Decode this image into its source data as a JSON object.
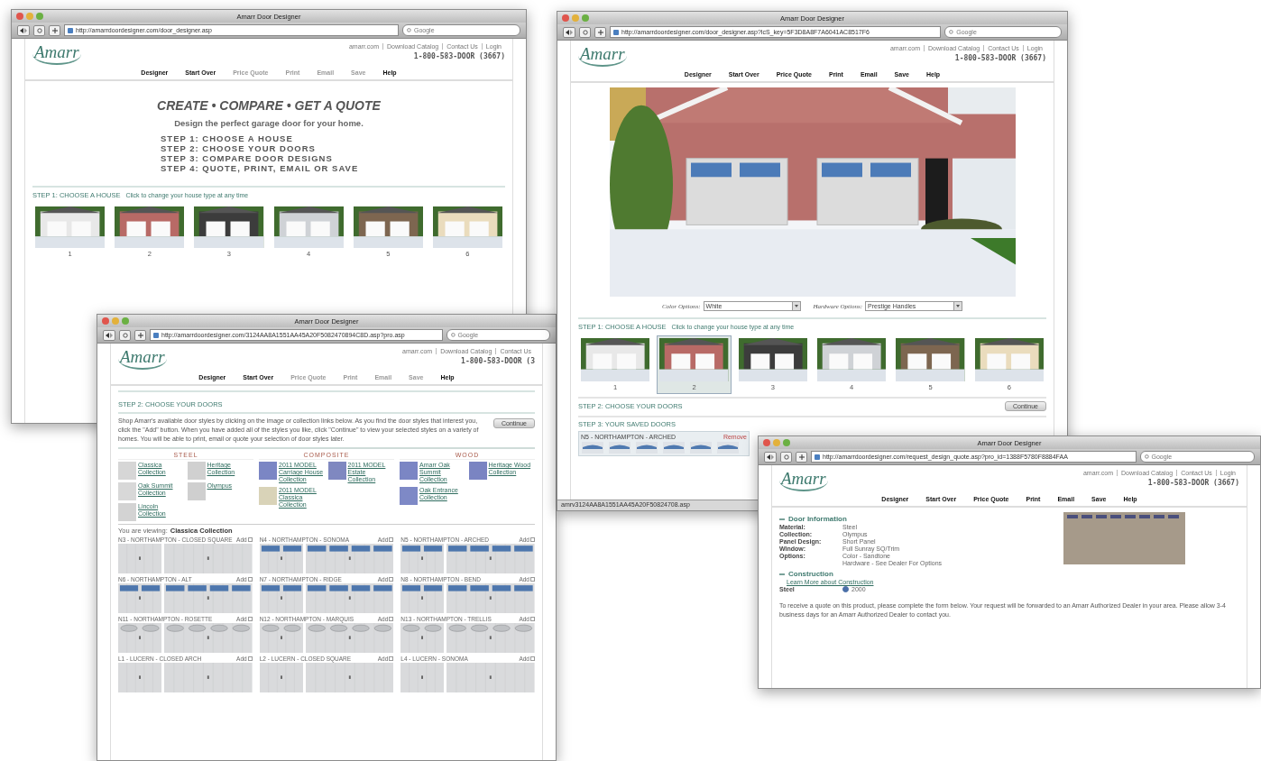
{
  "windows": [
    {
      "kind": "intro",
      "title": "Amarr Door Designer",
      "url": "http://amarrdoordesigner.com/door_designer.asp",
      "search_placeholder": "Google",
      "logo": "Amarr",
      "top_links": [
        "amarr.com",
        "Download Catalog",
        "Contact Us",
        "Login"
      ],
      "phone": "1-800-583-DOOR (3667)",
      "nav": [
        {
          "label": "Designer",
          "disabled": false
        },
        {
          "label": "Start Over",
          "disabled": false
        },
        {
          "label": "Price Quote",
          "disabled": true
        },
        {
          "label": "Print",
          "disabled": true
        },
        {
          "label": "Email",
          "disabled": true
        },
        {
          "label": "Save",
          "disabled": true
        },
        {
          "label": "Help",
          "disabled": false
        }
      ],
      "headline": "CREATE • COMPARE • GET A QUOTE",
      "subtitle": "Design the perfect garage door for your home.",
      "steps": [
        "STEP 1: CHOOSE A HOUSE",
        "STEP 2: CHOOSE YOUR DOORS",
        "STEP 3: COMPARE DOOR DESIGNS",
        "STEP 4: QUOTE, PRINT, EMAIL OR SAVE"
      ],
      "house_heading": "STEP 1: CHOOSE A HOUSE",
      "house_hint": "Click to change your house type at any time",
      "houses": [
        {
          "label": "1",
          "selected": false
        },
        {
          "label": "2",
          "selected": false
        },
        {
          "label": "3",
          "selected": false
        },
        {
          "label": "4",
          "selected": false
        },
        {
          "label": "5",
          "selected": false
        },
        {
          "label": "6",
          "selected": false
        }
      ]
    },
    {
      "kind": "catalog",
      "title": "Amarr Door Designer",
      "url": "http://amarrdoordesigner.com/3124AA8A1551AA45A20F5082470894C8D.asp?pro.asp",
      "search_placeholder": "Google",
      "logo": "Amarr",
      "top_links": [
        "amarr.com",
        "Download Catalog",
        "Contact Us"
      ],
      "phone": "1-800-583-DOOR (3",
      "nav": [
        {
          "label": "Designer",
          "disabled": false
        },
        {
          "label": "Start Over",
          "disabled": false
        },
        {
          "label": "Price Quote",
          "disabled": true
        },
        {
          "label": "Print",
          "disabled": true
        },
        {
          "label": "Email",
          "disabled": true
        },
        {
          "label": "Save",
          "disabled": true
        },
        {
          "label": "Help",
          "disabled": false
        }
      ],
      "section_heading": "STEP 2: CHOOSE YOUR DOORS",
      "intro": "Shop Amarr's available door styles by clicking on the image or collection links below. As you find the door styles that interest you, click the \"Add\" button. When you have added all of the styles you like, click \"Continue\" to view your selected styles on a variety of homes. You will be able to print, email or quote your selection of door styles later.",
      "continue_button": "Continue",
      "categories": [
        {
          "name": "STEEL",
          "items": [
            {
              "label": "Classica Collection"
            },
            {
              "label": "Heritage Collection"
            },
            {
              "label": "Oak Summit Collection"
            },
            {
              "label": "Olympus"
            },
            {
              "label": "Lincoln Collection"
            }
          ]
        },
        {
          "name": "COMPOSITE",
          "items": [
            {
              "label": "2011 MODEL Carriage House Collection"
            },
            {
              "label": "2011 MODEL Estate Collection"
            },
            {
              "label": "2011 MODEL Classica Collection"
            }
          ]
        },
        {
          "name": "WOOD",
          "items": [
            {
              "label": "Amarr Oak Summit Collection"
            },
            {
              "label": "Heritage Wood Collection"
            },
            {
              "label": "Oak Entrance Collection"
            }
          ]
        }
      ],
      "viewing_label": "You are viewing:",
      "viewing_value": "Classica Collection",
      "doors": [
        {
          "label": "N3 - NORTHAMPTON - CLOSED SQUARE",
          "add": "Add",
          "checked": false,
          "kind": "plain"
        },
        {
          "label": "N4 - NORTHAMPTON - SONOMA",
          "add": "Add",
          "checked": false,
          "kind": "glazed"
        },
        {
          "label": "N5 - NORTHAMPTON - ARCHED",
          "add": "Add",
          "checked": false,
          "kind": "glazed"
        },
        {
          "label": "N6 - NORTHAMPTON - ALT",
          "add": "Add",
          "checked": false,
          "kind": "glazed"
        },
        {
          "label": "N7 - NORTHAMPTON - RIDGE",
          "add": "Add",
          "checked": false,
          "kind": "glazed"
        },
        {
          "label": "N8 - NORTHAMPTON - BEND",
          "add": "Add",
          "checked": false,
          "kind": "glazed"
        },
        {
          "label": "N11 - NORTHAMPTON - ROSETTE",
          "add": "Add",
          "checked": false,
          "kind": "decorative"
        },
        {
          "label": "N12 - NORTHAMPTON - MARQUIS",
          "add": "Add",
          "checked": false,
          "kind": "decorative"
        },
        {
          "label": "N13 - NORTHAMPTON - TRELLIS",
          "add": "Add",
          "checked": false,
          "kind": "decorative"
        },
        {
          "label": "L1 - LUCERN - CLOSED ARCH",
          "add": "Add",
          "checked": false,
          "kind": "plain"
        },
        {
          "label": "L2 - LUCERN - CLOSED SQUARE",
          "add": "Add",
          "checked": false,
          "kind": "plain"
        },
        {
          "label": "L4 - LUCERN - SONOMA",
          "add": "Add",
          "checked": false,
          "kind": "plain"
        }
      ]
    },
    {
      "kind": "designer",
      "title": "Amarr Door Designer",
      "url": "http://amarrdoordesigner.com/door_designer.asp?lcS_key=5F3D8A8F7A6041AC8517F6",
      "search_placeholder": "Google",
      "logo": "Amarr",
      "top_links": [
        "amarr.com",
        "Download Catalog",
        "Contact Us",
        "Login"
      ],
      "phone": "1-800-583-DOOR (3667)",
      "nav": [
        {
          "label": "Designer",
          "disabled": false
        },
        {
          "label": "Start Over",
          "disabled": false
        },
        {
          "label": "Price Quote",
          "disabled": false
        },
        {
          "label": "Print",
          "disabled": false
        },
        {
          "label": "Email",
          "disabled": false
        },
        {
          "label": "Save",
          "disabled": false
        },
        {
          "label": "Help",
          "disabled": false
        }
      ],
      "color_label": "Color Options:",
      "color_value": "White",
      "hardware_label": "Hardware Options:",
      "hardware_value": "Prestige Handles",
      "house_heading": "STEP 1: CHOOSE A HOUSE",
      "house_hint": "Click to change your house type at any time",
      "houses": [
        {
          "label": "1",
          "selected": false
        },
        {
          "label": "2",
          "selected": true
        },
        {
          "label": "3",
          "selected": false
        },
        {
          "label": "4",
          "selected": false
        },
        {
          "label": "5",
          "selected": false
        },
        {
          "label": "6",
          "selected": false
        }
      ],
      "step2_heading": "STEP 2: CHOOSE YOUR DOORS",
      "step2_button": "Continue",
      "step3_heading": "STEP 3: YOUR SAVED DOORS",
      "saved": {
        "label": "N5 - NORTHAMPTON - ARCHED",
        "remove": "Remove"
      },
      "status": "amrv3124AA8A1551AA45A20F50824708.asp"
    },
    {
      "kind": "quote",
      "title": "Amarr Door Designer",
      "url": "http://amarrdoordesigner.com/request_design_quote.asp?pro_id=1388F5780F8884FAA",
      "search_placeholder": "Google",
      "logo": "Amarr",
      "top_links": [
        "amarr.com",
        "Download Catalog",
        "Contact Us",
        "Login"
      ],
      "phone": "1-800-583-DOOR (3667)",
      "nav": [
        {
          "label": "Designer",
          "disabled": false
        },
        {
          "label": "Start Over",
          "disabled": false
        },
        {
          "label": "Price Quote",
          "disabled": false
        },
        {
          "label": "Print",
          "disabled": false
        },
        {
          "label": "Email",
          "disabled": false
        },
        {
          "label": "Save",
          "disabled": false
        },
        {
          "label": "Help",
          "disabled": false
        }
      ],
      "info_heading": "Door Information",
      "expanded": true,
      "construction_expanded": true,
      "fields": [
        {
          "label": "Material:",
          "value": "Steel"
        },
        {
          "label": "Collection:",
          "value": "Olympus"
        },
        {
          "label": "Panel Design:",
          "value": "Short Panel"
        },
        {
          "label": "Window:",
          "value": "Full Sunray SQ/Trim"
        },
        {
          "label": "Options:",
          "value": "Color - Sandtone"
        },
        {
          "value": "Hardware - See Dealer For Options"
        }
      ],
      "construction_heading": "Construction",
      "construction_link": "Learn More about Construction",
      "construction_label": "Steel",
      "construction_option": {
        "label": "2000",
        "selected": true
      },
      "note": "To receive a quote on this product, please complete the form below. Your request will be forwarded to an Amarr Authorized Dealer in your area. Please allow 3-4 business days for an Amarr Authorized Dealer to contact you."
    }
  ]
}
